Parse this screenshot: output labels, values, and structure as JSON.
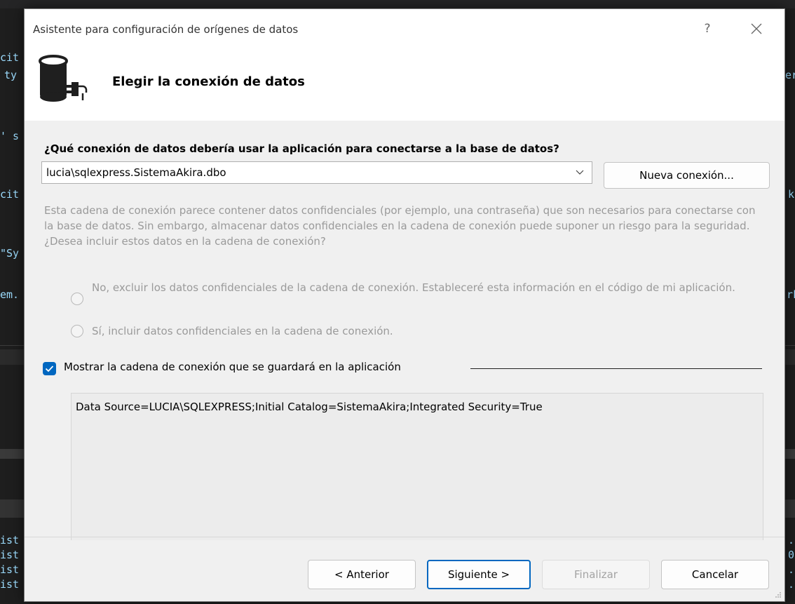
{
  "dialog": {
    "title": "Asistente para configuración de orígenes de datos",
    "help_label": "?",
    "heading": "Elegir la conexión de datos"
  },
  "connection": {
    "question": "¿Qué conexión de datos debería usar la aplicación para conectarse a la base de datos?",
    "selected": "lucia\\sqlexpress.SistemaAkira.dbo",
    "new_button": "Nueva conexión...",
    "info": "Esta cadena de conexión parece contener datos confidenciales (por ejemplo, una contraseña) que son necesarios para conectarse con la base de datos. Sin embargo, almacenar datos confidenciales en la cadena de conexión puede suponer un riesgo para la seguridad. ¿Desea incluir estos datos en la cadena de conexión?",
    "option_no": "No, excluir los datos confidenciales de la cadena de conexión. Estableceré esta información en el código de mi aplicación.",
    "option_yes": "Sí, incluir datos confidenciales en la cadena de conexión.",
    "show_string_label": "Mostrar la cadena de conexión que se guardará en la aplicación",
    "show_string_checked": true,
    "connection_string": "Data Source=LUCIA\\SQLEXPRESS;Initial Catalog=SistemaAkira;Integrated Security=True"
  },
  "footer": {
    "back": "< Anterior",
    "next": "Siguiente >",
    "finish": "Finalizar",
    "cancel": "Cancelar"
  },
  "background": {
    "left_fragments": [
      "cit",
      "ty",
      "' s",
      "cit",
      "\"Sy",
      "em.",
      "ist",
      "ist",
      "ist",
      "ist"
    ],
    "right_fragments": [
      "er",
      "k:",
      "rk",
      ".",
      "0",
      ".",
      "."
    ]
  },
  "colors": {
    "accent": "#0067c0"
  }
}
